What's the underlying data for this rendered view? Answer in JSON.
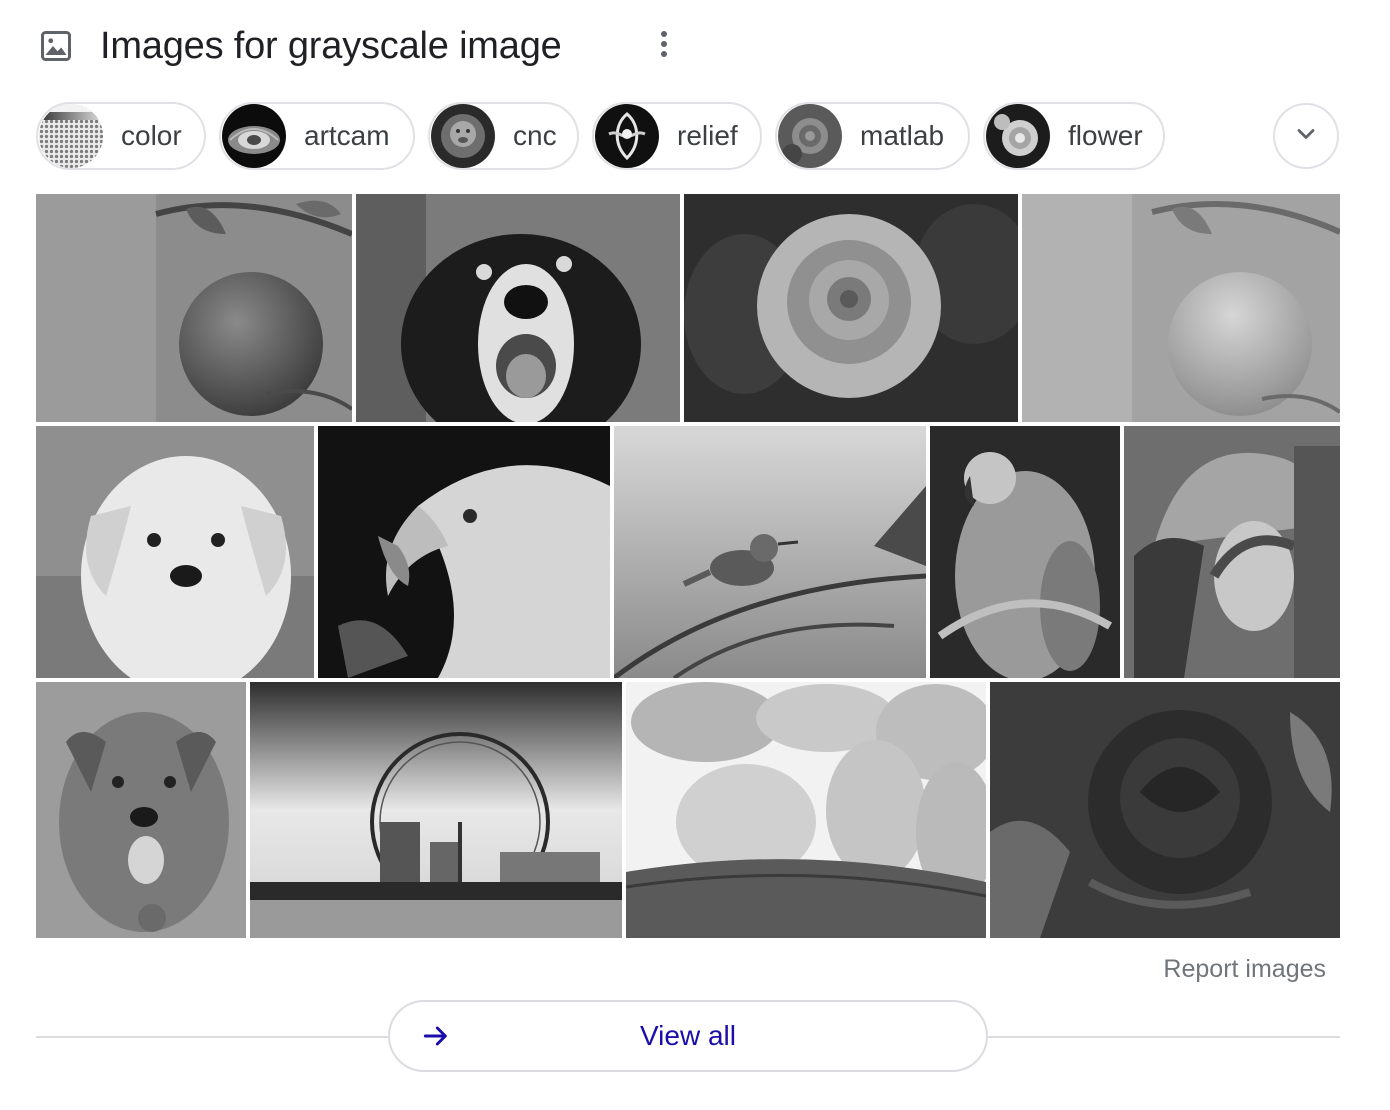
{
  "header": {
    "title": "Images for grayscale image",
    "icon": "image-icon",
    "more_icon": "more-vert-icon"
  },
  "chips": [
    {
      "label": "color"
    },
    {
      "label": "artcam"
    },
    {
      "label": "cnc"
    },
    {
      "label": "relief"
    },
    {
      "label": "matlab"
    },
    {
      "label": "flower"
    }
  ],
  "chips_expand_icon": "chevron-down-icon",
  "images": [
    {
      "subject": "apple"
    },
    {
      "subject": "dog"
    },
    {
      "subject": "rose"
    },
    {
      "subject": "apple-light"
    },
    {
      "subject": "puppy"
    },
    {
      "subject": "eagle"
    },
    {
      "subject": "bird"
    },
    {
      "subject": "parrot"
    },
    {
      "subject": "woman-in-hat"
    },
    {
      "subject": "dog-portrait"
    },
    {
      "subject": "ferris-wheel"
    },
    {
      "subject": "potatoes"
    },
    {
      "subject": "rose-dark"
    }
  ],
  "footer": {
    "report_label": "Report images",
    "view_all_label": "View all",
    "view_all_icon": "arrow-right-icon"
  },
  "colors": {
    "link": "#1a0dab",
    "chip_border": "#dfe1e5",
    "muted_text": "#70757a"
  }
}
